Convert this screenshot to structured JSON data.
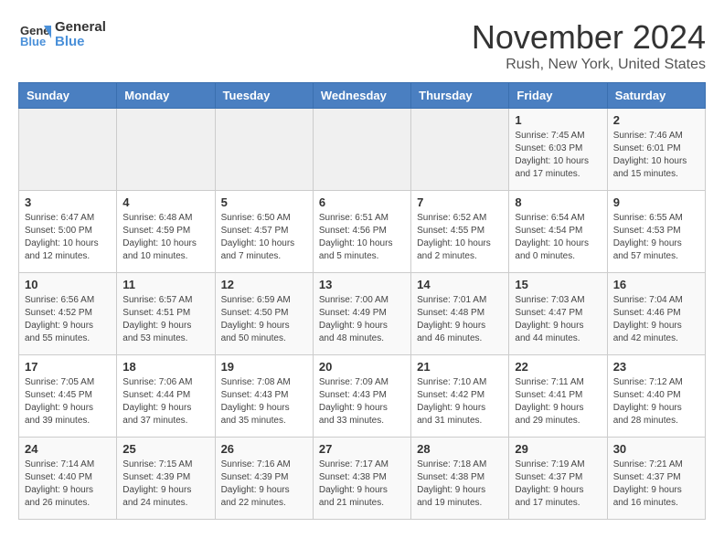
{
  "app": {
    "logo_line1": "General",
    "logo_line2": "Blue",
    "title": "November 2024",
    "subtitle": "Rush, New York, United States"
  },
  "calendar": {
    "headers": [
      "Sunday",
      "Monday",
      "Tuesday",
      "Wednesday",
      "Thursday",
      "Friday",
      "Saturday"
    ],
    "weeks": [
      [
        {
          "day": "",
          "info": ""
        },
        {
          "day": "",
          "info": ""
        },
        {
          "day": "",
          "info": ""
        },
        {
          "day": "",
          "info": ""
        },
        {
          "day": "",
          "info": ""
        },
        {
          "day": "1",
          "info": "Sunrise: 7:45 AM\nSunset: 6:03 PM\nDaylight: 10 hours and 17 minutes."
        },
        {
          "day": "2",
          "info": "Sunrise: 7:46 AM\nSunset: 6:01 PM\nDaylight: 10 hours and 15 minutes."
        }
      ],
      [
        {
          "day": "3",
          "info": "Sunrise: 6:47 AM\nSunset: 5:00 PM\nDaylight: 10 hours and 12 minutes."
        },
        {
          "day": "4",
          "info": "Sunrise: 6:48 AM\nSunset: 4:59 PM\nDaylight: 10 hours and 10 minutes."
        },
        {
          "day": "5",
          "info": "Sunrise: 6:50 AM\nSunset: 4:57 PM\nDaylight: 10 hours and 7 minutes."
        },
        {
          "day": "6",
          "info": "Sunrise: 6:51 AM\nSunset: 4:56 PM\nDaylight: 10 hours and 5 minutes."
        },
        {
          "day": "7",
          "info": "Sunrise: 6:52 AM\nSunset: 4:55 PM\nDaylight: 10 hours and 2 minutes."
        },
        {
          "day": "8",
          "info": "Sunrise: 6:54 AM\nSunset: 4:54 PM\nDaylight: 10 hours and 0 minutes."
        },
        {
          "day": "9",
          "info": "Sunrise: 6:55 AM\nSunset: 4:53 PM\nDaylight: 9 hours and 57 minutes."
        }
      ],
      [
        {
          "day": "10",
          "info": "Sunrise: 6:56 AM\nSunset: 4:52 PM\nDaylight: 9 hours and 55 minutes."
        },
        {
          "day": "11",
          "info": "Sunrise: 6:57 AM\nSunset: 4:51 PM\nDaylight: 9 hours and 53 minutes."
        },
        {
          "day": "12",
          "info": "Sunrise: 6:59 AM\nSunset: 4:50 PM\nDaylight: 9 hours and 50 minutes."
        },
        {
          "day": "13",
          "info": "Sunrise: 7:00 AM\nSunset: 4:49 PM\nDaylight: 9 hours and 48 minutes."
        },
        {
          "day": "14",
          "info": "Sunrise: 7:01 AM\nSunset: 4:48 PM\nDaylight: 9 hours and 46 minutes."
        },
        {
          "day": "15",
          "info": "Sunrise: 7:03 AM\nSunset: 4:47 PM\nDaylight: 9 hours and 44 minutes."
        },
        {
          "day": "16",
          "info": "Sunrise: 7:04 AM\nSunset: 4:46 PM\nDaylight: 9 hours and 42 minutes."
        }
      ],
      [
        {
          "day": "17",
          "info": "Sunrise: 7:05 AM\nSunset: 4:45 PM\nDaylight: 9 hours and 39 minutes."
        },
        {
          "day": "18",
          "info": "Sunrise: 7:06 AM\nSunset: 4:44 PM\nDaylight: 9 hours and 37 minutes."
        },
        {
          "day": "19",
          "info": "Sunrise: 7:08 AM\nSunset: 4:43 PM\nDaylight: 9 hours and 35 minutes."
        },
        {
          "day": "20",
          "info": "Sunrise: 7:09 AM\nSunset: 4:43 PM\nDaylight: 9 hours and 33 minutes."
        },
        {
          "day": "21",
          "info": "Sunrise: 7:10 AM\nSunset: 4:42 PM\nDaylight: 9 hours and 31 minutes."
        },
        {
          "day": "22",
          "info": "Sunrise: 7:11 AM\nSunset: 4:41 PM\nDaylight: 9 hours and 29 minutes."
        },
        {
          "day": "23",
          "info": "Sunrise: 7:12 AM\nSunset: 4:40 PM\nDaylight: 9 hours and 28 minutes."
        }
      ],
      [
        {
          "day": "24",
          "info": "Sunrise: 7:14 AM\nSunset: 4:40 PM\nDaylight: 9 hours and 26 minutes."
        },
        {
          "day": "25",
          "info": "Sunrise: 7:15 AM\nSunset: 4:39 PM\nDaylight: 9 hours and 24 minutes."
        },
        {
          "day": "26",
          "info": "Sunrise: 7:16 AM\nSunset: 4:39 PM\nDaylight: 9 hours and 22 minutes."
        },
        {
          "day": "27",
          "info": "Sunrise: 7:17 AM\nSunset: 4:38 PM\nDaylight: 9 hours and 21 minutes."
        },
        {
          "day": "28",
          "info": "Sunrise: 7:18 AM\nSunset: 4:38 PM\nDaylight: 9 hours and 19 minutes."
        },
        {
          "day": "29",
          "info": "Sunrise: 7:19 AM\nSunset: 4:37 PM\nDaylight: 9 hours and 17 minutes."
        },
        {
          "day": "30",
          "info": "Sunrise: 7:21 AM\nSunset: 4:37 PM\nDaylight: 9 hours and 16 minutes."
        }
      ]
    ]
  }
}
